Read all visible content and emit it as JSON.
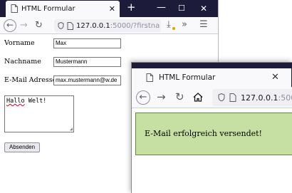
{
  "window1": {
    "tab_title": "HTML Formular",
    "url_host": "127.0.0.1",
    "url_rest": ":5000/?firstna",
    "form": {
      "vorname_label": "Vorname",
      "vorname_value": "Max",
      "nachname_label": "Nachname",
      "nachname_value": "Mustermann",
      "email_label": "E-Mail Adresse",
      "email_value": "max.mustermann@w.de",
      "message_word1": "Hallo",
      "message_word2": " Welt!",
      "submit_label": "Absenden"
    }
  },
  "window2": {
    "tab_title": "HTML Formular",
    "url_host": "127.0.0.1",
    "url_rest": ":5000",
    "success_message": "E-Mail erfolgreich versendet!"
  },
  "colors": {
    "titlebar": "#1c1b3a",
    "success_bg": "#c6e0a3",
    "success_border": "#5f8a3f"
  }
}
